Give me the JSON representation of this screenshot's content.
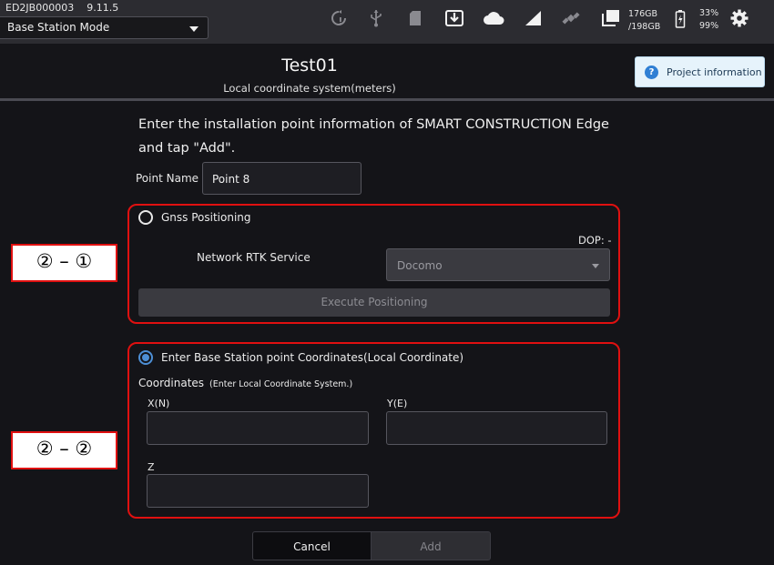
{
  "status_bar": {
    "device_id": "ED2JB000003",
    "version": "9.11.5",
    "mode": "Base Station Mode",
    "storage_used": "176GB",
    "storage_total": "/198GB",
    "battery_1": "33%",
    "battery_2": "99%",
    "icons": [
      "sync-alert-icon",
      "usb-icon",
      "sd-card-icon",
      "download-icon",
      "cloud-icon",
      "signal-icon",
      "satellite-icon",
      "copy-icon",
      "battery-icon",
      "gear-icon"
    ]
  },
  "header": {
    "title": "Test01",
    "subtitle": "Local coordinate system(meters)",
    "project_info_label": "Project information"
  },
  "form": {
    "instruction": "Enter the installation point information of SMART CONSTRUCTION Edge and tap \"Add\".",
    "point_name_label": "Point Name",
    "point_name_value": "Point 8",
    "gnss": {
      "label": "Gnss Positioning",
      "selected": false,
      "dop": "DOP: -",
      "rtk_label": "Network RTK Service",
      "rtk_value": "Docomo",
      "execute_label": "Execute Positioning"
    },
    "base": {
      "label": "Enter Base Station point Coordinates(Local Coordinate)",
      "selected": true,
      "coords_label": "Coordinates",
      "coords_note": "(Enter Local Coordinate System.)",
      "x_label": "X(N)",
      "y_label": "Y(E)",
      "z_label": "Z",
      "x_value": "",
      "y_value": "",
      "z_value": ""
    },
    "cancel_label": "Cancel",
    "add_label": "Add"
  },
  "annotations": {
    "callout_1": "② – ①",
    "callout_2": "② – ②",
    "highlight_color": "#e01010"
  },
  "colors": {
    "accent_blue": "#4d8fd6",
    "background": "#141418",
    "status_bar": "#2c2c31"
  }
}
